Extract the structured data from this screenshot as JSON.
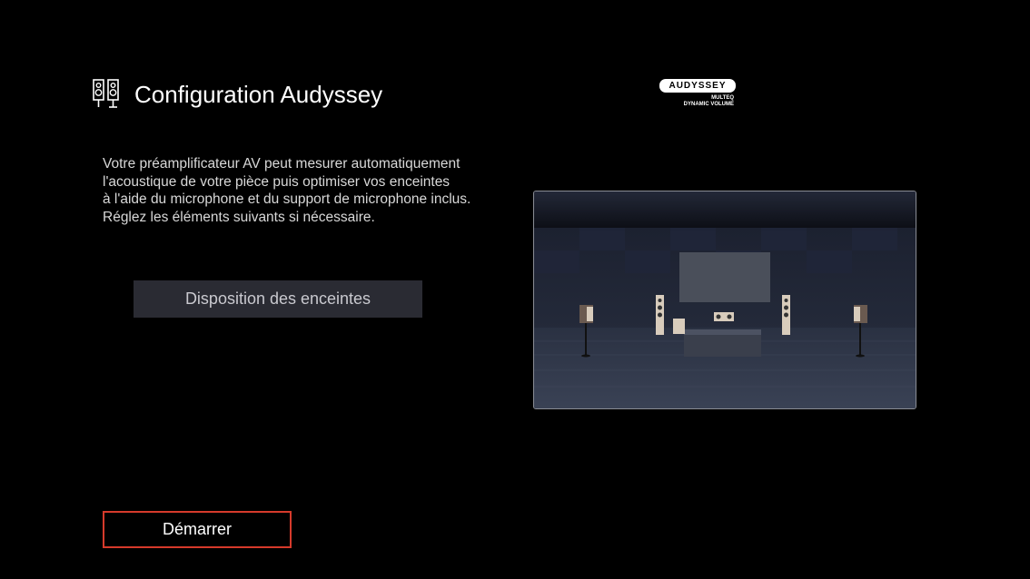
{
  "header": {
    "title": "Configuration Audyssey",
    "icon": "speaker-icon"
  },
  "logo": {
    "brand": "AUDYSSEY",
    "line1": "MULTEQ",
    "line2": "DYNAMIC VOLUME"
  },
  "description": {
    "lines": [
      "Votre préamplificateur AV peut mesurer automatiquement",
      "l'acoustique de votre pièce puis optimiser vos enceintes",
      "à l'aide du microphone et du support de microphone inclus.",
      "Réglez les éléments suivants si nécessaire."
    ]
  },
  "buttons": {
    "speaker_layout": "Disposition des enceintes",
    "start": "Démarrer"
  },
  "colors": {
    "background": "#000000",
    "focus_border": "#d63a2b",
    "button_bg": "#2a2b33"
  }
}
